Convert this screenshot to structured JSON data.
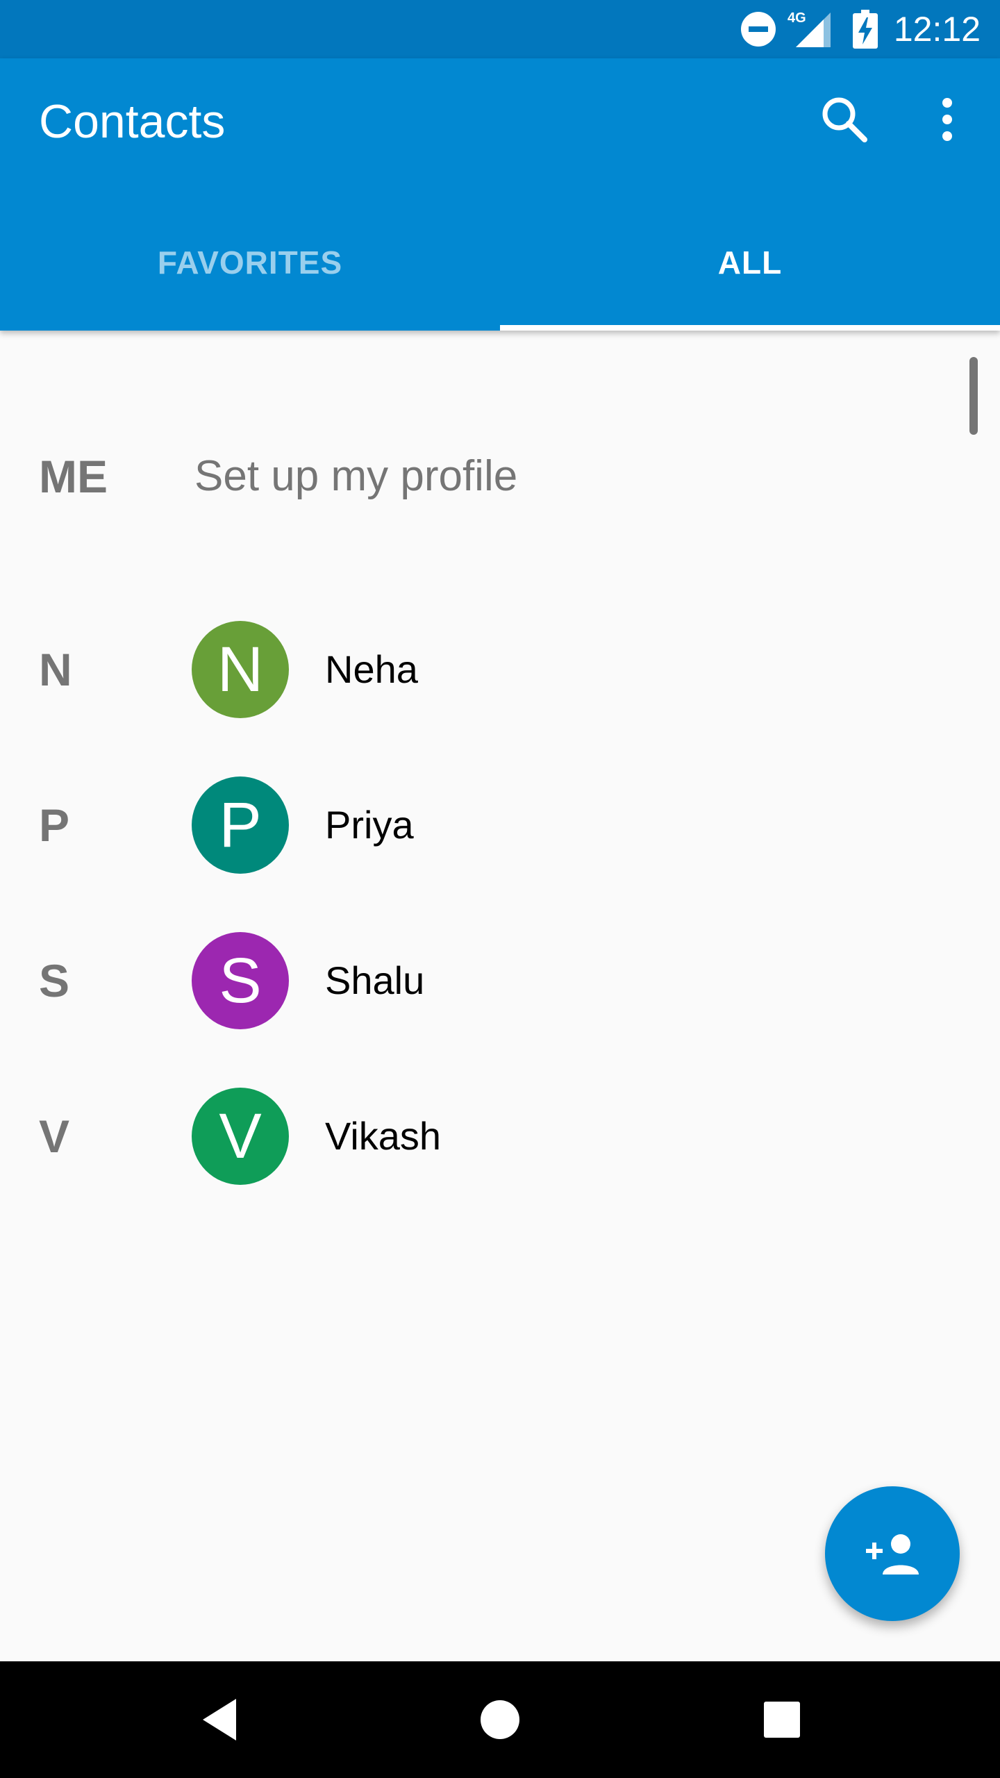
{
  "status_bar": {
    "time": "12:12",
    "network_label": "4G",
    "icons": [
      "do-not-disturb-icon",
      "signal-icon",
      "battery-charging-icon"
    ]
  },
  "app_bar": {
    "title": "Contacts",
    "actions": [
      "search-icon",
      "more-vert-icon"
    ]
  },
  "tabs": [
    {
      "label": "FAVORITES",
      "active": false
    },
    {
      "label": "ALL",
      "active": true
    }
  ],
  "me_section": {
    "letter": "ME",
    "text": "Set up my profile"
  },
  "contacts": [
    {
      "section": "N",
      "initial": "N",
      "name": "Neha",
      "color": "#689f38"
    },
    {
      "section": "P",
      "initial": "P",
      "name": "Priya",
      "color": "#00897b"
    },
    {
      "section": "S",
      "initial": "S",
      "name": "Shalu",
      "color": "#9c27b0"
    },
    {
      "section": "V",
      "initial": "V",
      "name": "Vikash",
      "color": "#0f9d58"
    }
  ],
  "fab": {
    "icon": "add-person-icon"
  },
  "nav_bar": {
    "buttons": [
      "back-icon",
      "home-icon",
      "recents-icon"
    ]
  },
  "colors": {
    "status_bar": "#0277bd",
    "app_bar": "#0288d1",
    "background": "#fafafa",
    "fab": "#0288d1"
  }
}
